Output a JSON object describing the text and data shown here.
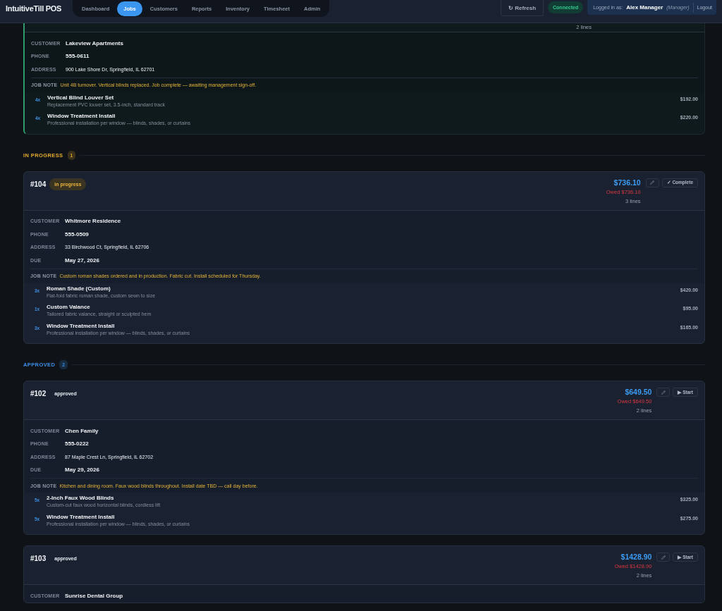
{
  "app": {
    "title": "IntuitiveTill POS"
  },
  "nav": [
    {
      "label": "Dashboard",
      "selected": false
    },
    {
      "label": "Jobs",
      "selected": true
    },
    {
      "label": "Customers",
      "selected": false
    },
    {
      "label": "Reports",
      "selected": false
    },
    {
      "label": "Inventory",
      "selected": false
    },
    {
      "label": "Timesheet",
      "selected": false
    },
    {
      "label": "Admin",
      "selected": false
    }
  ],
  "toolbar": {
    "refresh": "↻ Refresh",
    "connection": "Connected",
    "logged_in_label": "Logged in as:",
    "user": "Alex Manager",
    "role": "(Manager)",
    "logout": "Logout"
  },
  "groups": [
    {
      "jobs": [
        {
          "kind": "complete",
          "lines": "2 lines",
          "fields": [
            {
              "label": "CUSTOMER",
              "value": "Lakeview Apartments",
              "bold": true
            },
            {
              "label": "PHONE",
              "value": "555-0611",
              "bold": true
            },
            {
              "label": "ADDRESS",
              "value": "900 Lake Shore Dr, Springfield, IL 62701",
              "bold": false
            }
          ],
          "note": {
            "label": "JOB NOTE",
            "text": "Unit 4B turnover. Vertical blinds replaced. Job complete — awaiting management sign-off."
          },
          "items": [
            {
              "qty": "4x",
              "name": "Vertical Blind Louver Set",
              "desc": "Replacement PVC louver set, 3.5-inch, standard track",
              "price": "$192.00"
            },
            {
              "qty": "4x",
              "name": "Window Treatment Install",
              "desc": "Professional installation per window — blinds, shades, or curtains",
              "price": "$220.00"
            }
          ]
        }
      ]
    },
    {
      "title": "IN PROGRESS",
      "count": "1",
      "color": "#e3a92b",
      "jobs": [
        {
          "kind": "in_progress",
          "id": "#104",
          "status": "in progress",
          "total": "$736.10",
          "owed": "Owed $736.10",
          "lines": "3 lines",
          "action": "✓ Complete",
          "fields": [
            {
              "label": "CUSTOMER",
              "value": "Whitmore Residence",
              "bold": true
            },
            {
              "label": "PHONE",
              "value": "555-0509",
              "bold": true
            },
            {
              "label": "ADDRESS",
              "value": "33 Birchwood Ct, Springfield, IL 62706",
              "bold": false
            },
            {
              "label": "DUE",
              "value": "May 27, 2026",
              "bold": true
            }
          ],
          "note": {
            "label": "JOB NOTE",
            "text": "Custom roman shades ordered and in production. Fabric cut. Install scheduled for Thursday."
          },
          "items": [
            {
              "qty": "3x",
              "name": "Roman Shade (Custom)",
              "desc": "Flat-fold fabric roman shade, custom sewn to size",
              "price": "$420.00"
            },
            {
              "qty": "1x",
              "name": "Custom Valance",
              "desc": "Tailored fabric valance, straight or sculpted hem",
              "price": "$95.00"
            },
            {
              "qty": "3x",
              "name": "Window Treatment Install",
              "desc": "Professional installation per window — blinds, shades, or curtains",
              "price": "$165.00"
            }
          ]
        }
      ]
    },
    {
      "title": "APPROVED",
      "count": "2",
      "color": "#3b8fe8",
      "jobs": [
        {
          "kind": "approved",
          "id": "#102",
          "status": "approved",
          "total": "$649.50",
          "owed": "Owed $649.50",
          "lines": "2 lines",
          "action": "▶ Start",
          "fields": [
            {
              "label": "CUSTOMER",
              "value": "Chen Family",
              "bold": true
            },
            {
              "label": "PHONE",
              "value": "555-0222",
              "bold": true
            },
            {
              "label": "ADDRESS",
              "value": "87 Maple Crest Ln, Springfield, IL 62702",
              "bold": false
            },
            {
              "label": "DUE",
              "value": "May 29, 2026",
              "bold": true
            }
          ],
          "note": {
            "label": "JOB NOTE",
            "text": "Kitchen and dining room. Faux wood blinds throughout. Install date TBD — call day before."
          },
          "items": [
            {
              "qty": "5x",
              "name": "2-Inch Faux Wood Blinds",
              "desc": "Custom-cut faux wood horizontal blinds, cordless lift",
              "price": "$325.00"
            },
            {
              "qty": "5x",
              "name": "Window Treatment Install",
              "desc": "Professional installation per window — blinds, shades, or curtains",
              "price": "$275.00"
            }
          ]
        },
        {
          "kind": "approved",
          "id": "#103",
          "status": "approved",
          "total": "$1428.90",
          "owed": "Owed $1428.90",
          "lines": "2 lines",
          "action": "▶ Start",
          "fields": [
            {
              "label": "CUSTOMER",
              "value": "Sunrise Dental Group",
              "bold": true
            }
          ]
        }
      ]
    }
  ]
}
